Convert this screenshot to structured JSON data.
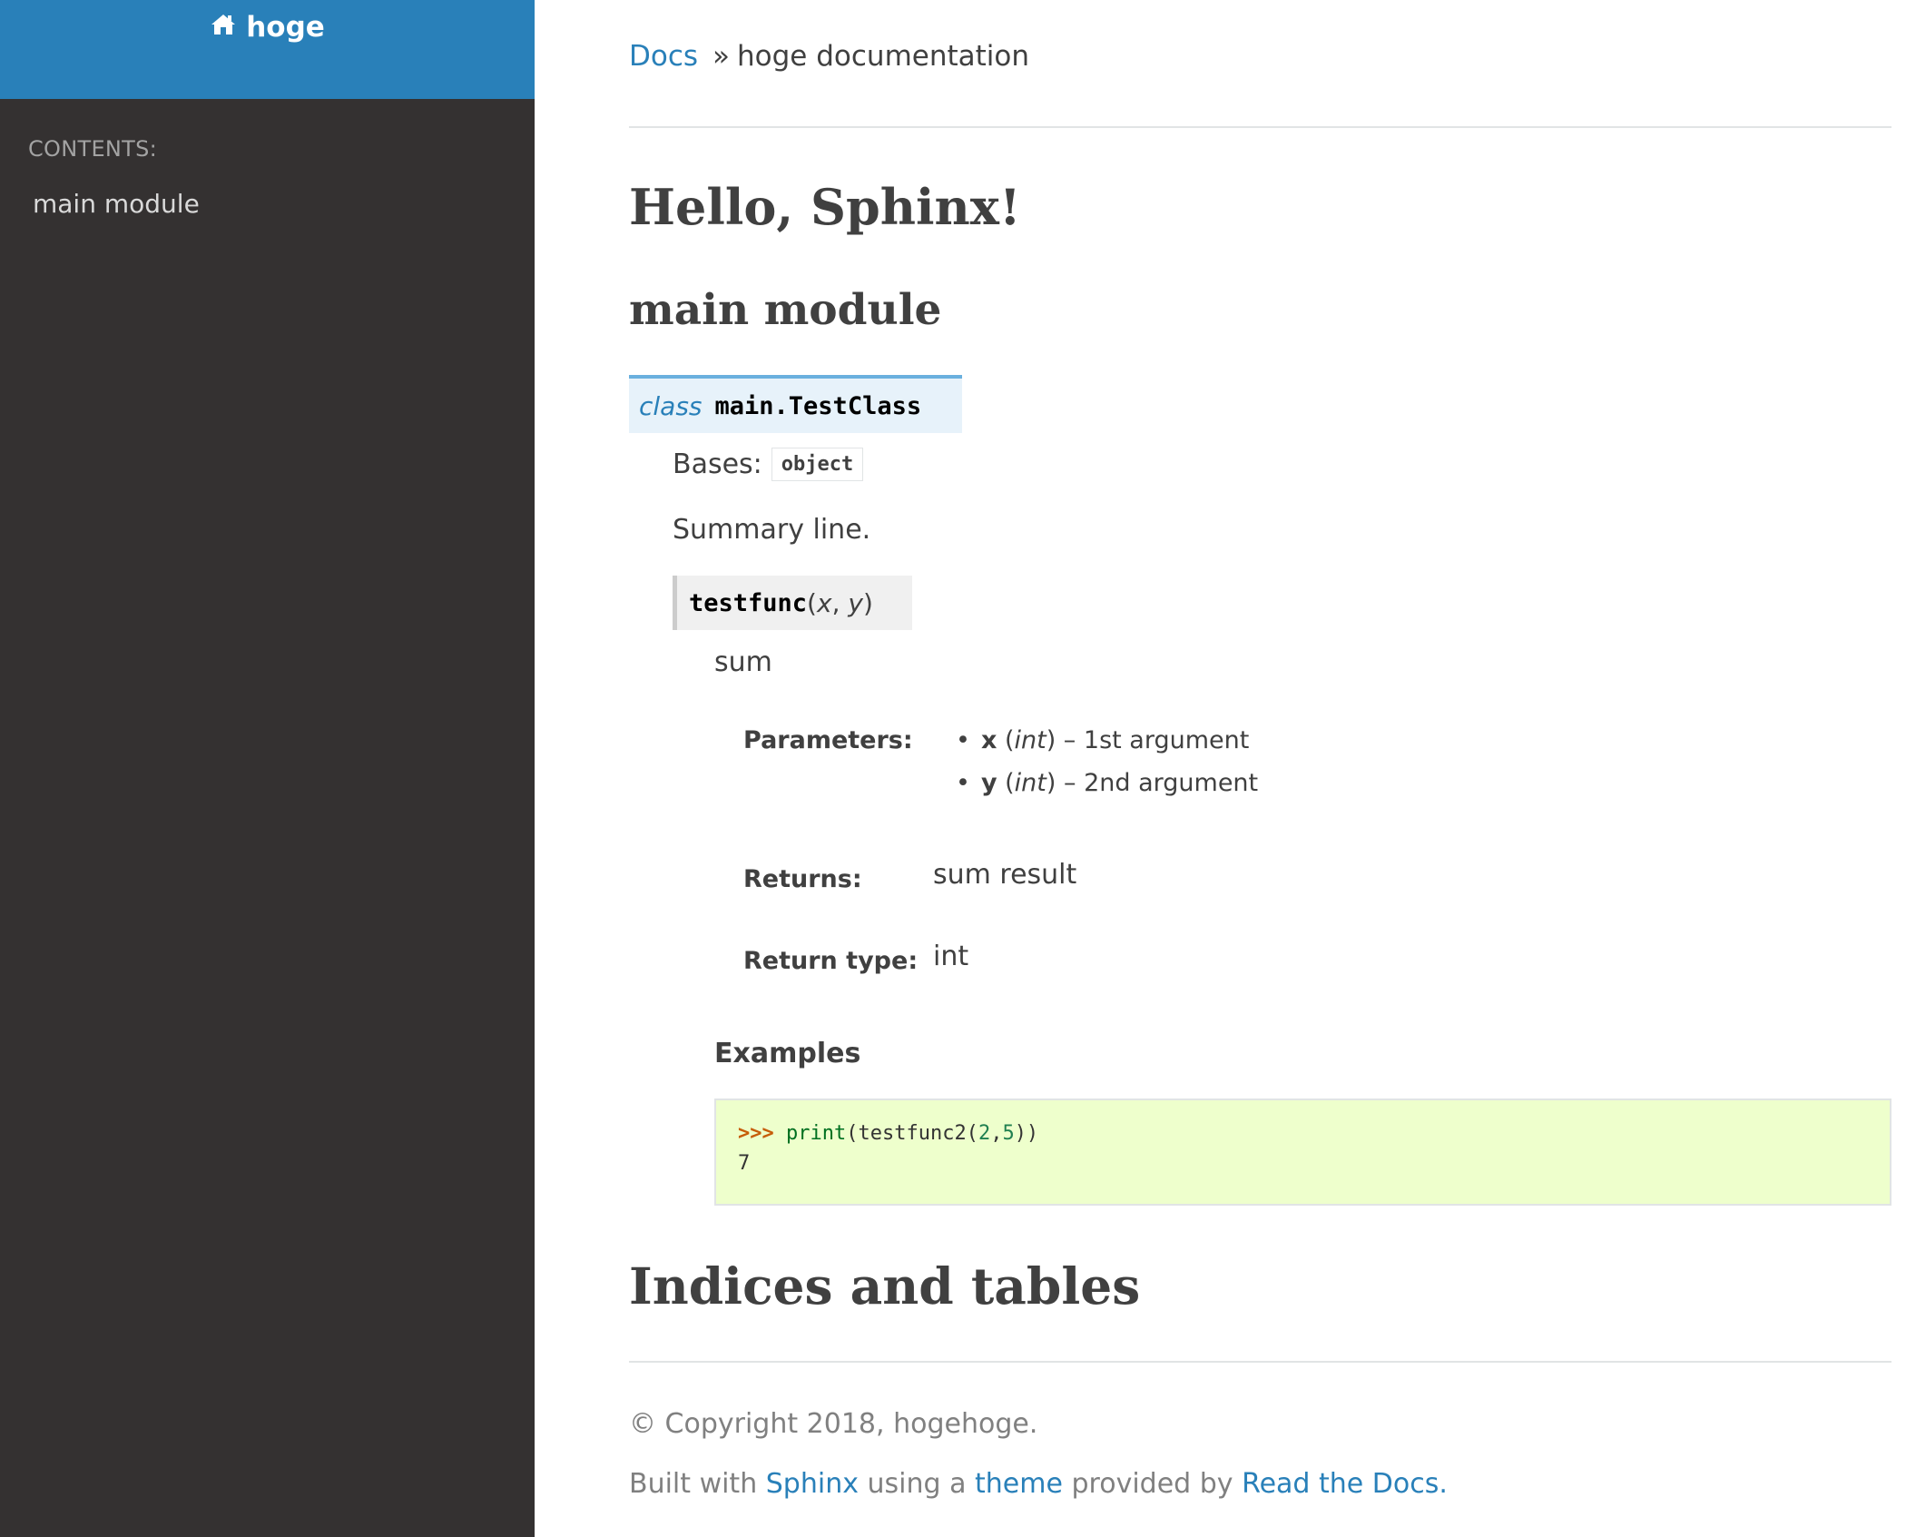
{
  "sidebar": {
    "project_name": "hoge",
    "home_icon": "home-icon",
    "caption": "CONTENTS:",
    "items": [
      {
        "label": "main module"
      }
    ],
    "colors": {
      "header_bg": "#2980b9",
      "nav_bg": "#343131"
    }
  },
  "breadcrumb": {
    "root_label": "Docs",
    "separator": "»",
    "current": "hoge documentation"
  },
  "page": {
    "title": "Hello, Sphinx!",
    "section_title": "main module",
    "class_sig": {
      "keyword": "class",
      "name": "main.TestClass"
    },
    "bases_label": "Bases:",
    "bases_value": "object",
    "summary": "Summary line.",
    "method_sig": {
      "name": "testfunc",
      "open": "(",
      "arg1": "x",
      "comma": ", ",
      "arg2": "y",
      "close": ")"
    },
    "method_desc": "sum",
    "fields": {
      "parameters_label": "Parameters:",
      "parameters": [
        {
          "name": "x",
          "type": "int",
          "desc": "1st argument"
        },
        {
          "name": "y",
          "type": "int",
          "desc": "2nd argument"
        }
      ],
      "returns_label": "Returns:",
      "returns_value": "sum result",
      "return_type_label": "Return type:",
      "return_type_value": "int"
    },
    "examples_heading": "Examples",
    "code": {
      "prompt": ">>>",
      "builtin": "print",
      "call_open": "(testfunc2(",
      "arg_a": "2",
      "comma": ",",
      "arg_b": "5",
      "call_close": "))",
      "output": "7"
    },
    "indices_title": "Indices and tables"
  },
  "footer": {
    "copyright": "© Copyright 2018, hogehoge.",
    "built_with": "Built with",
    "sphinx_link": "Sphinx",
    "using_a": "using a",
    "theme_link": "theme",
    "provided_by": "provided by",
    "rtd_link": "Read the Docs",
    "period": "."
  }
}
